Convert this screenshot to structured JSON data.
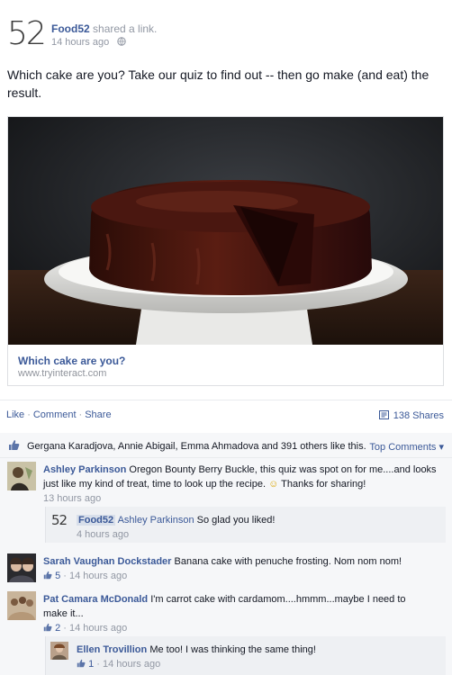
{
  "post": {
    "page_name": "Food52",
    "action": "shared a link.",
    "time": "14 hours ago",
    "logo_text": "52",
    "message": "Which cake are you? Take our quiz to find out -- then go make (and eat) the result."
  },
  "link": {
    "title": "Which cake are you?",
    "domain": "www.tryinteract.com"
  },
  "actions": {
    "like": "Like",
    "comment": "Comment",
    "share": "Share",
    "separator": "·",
    "shares_count": "138 Shares"
  },
  "likes": {
    "summary": "Gergana Karadjova, Annie Abigail, Emma Ahmadova and 391 others like this.",
    "sort_label": "Top Comments",
    "sort_arrow": "▾"
  },
  "comments": [
    {
      "name": "Ashley Parkinson",
      "text": "Oregon Bounty Berry Buckle, this quiz was spot on for me....and looks just like my kind of treat, time to look up the recipe.",
      "text_after": "Thanks for sharing!",
      "emoji": "☺",
      "meta": "13 hours ago"
    },
    {
      "name": "Food52",
      "logo_text": "52",
      "tag": "Ashley Parkinson",
      "text": "So glad you liked!",
      "meta": "4 hours ago"
    },
    {
      "name": "Sarah Vaughan Dockstader",
      "text": "Banana cake with penuche frosting. Nom nom nom!",
      "likes": "5",
      "meta": "14 hours ago"
    },
    {
      "name": "Pat Camara McDonald",
      "text": "I'm carrot cake with cardamom....hmmm...maybe I need to make it...",
      "likes": "2",
      "meta": "14 hours ago"
    },
    {
      "name": "Ellen Trovillion",
      "text": "Me too! I was thinking the same thing!",
      "likes": "1",
      "meta": "14 hours ago"
    }
  ],
  "colors": {
    "link_blue": "#3b5998",
    "meta_gray": "#9197a3",
    "ufi_bg": "#f6f7f9"
  },
  "icons": {
    "globe": "globe-icon",
    "like": "like-thumb-icon",
    "shares": "shares-icon"
  }
}
